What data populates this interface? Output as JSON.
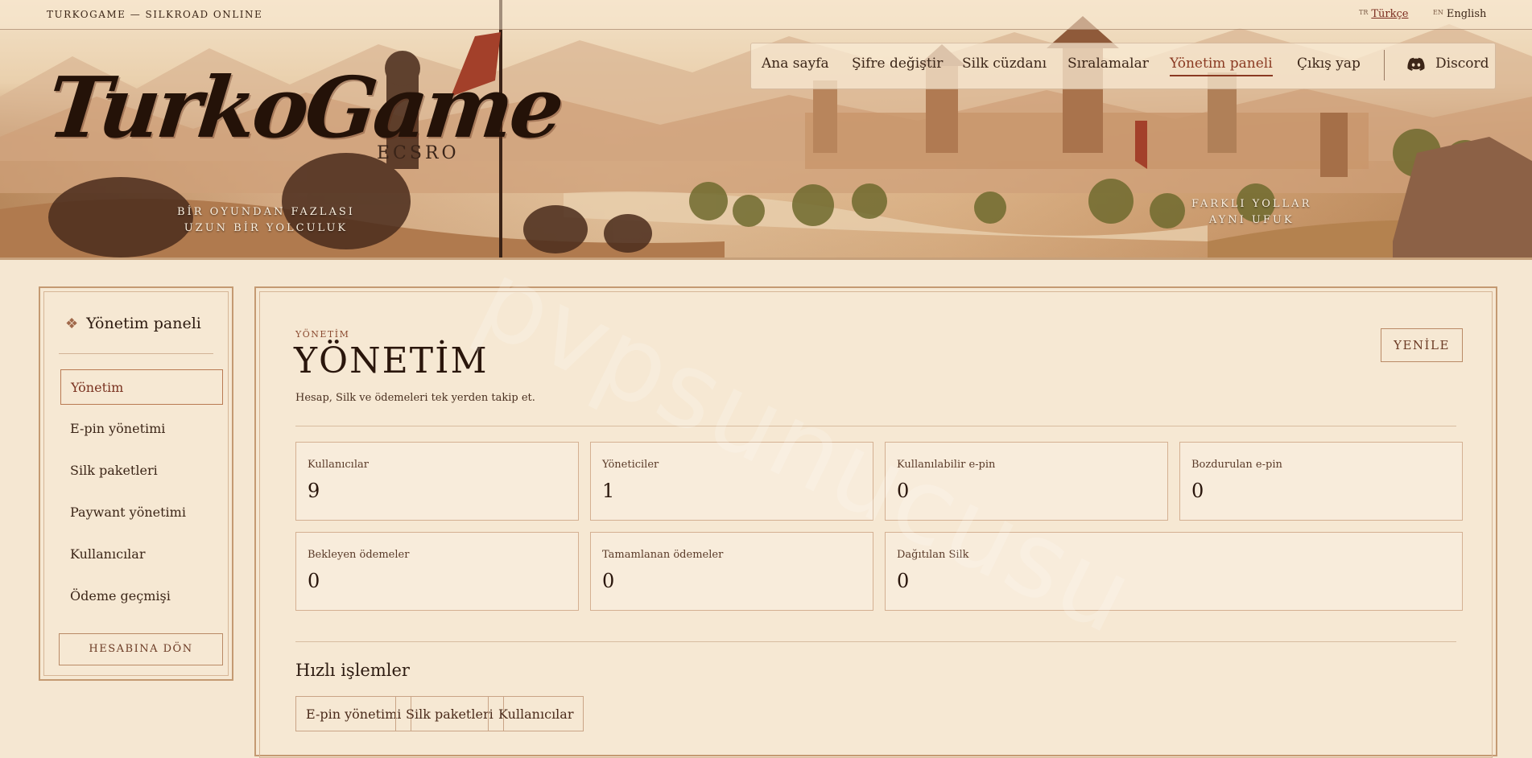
{
  "topbar": {
    "brand": "TURKOGAME — SILKROAD ONLINE",
    "languages": [
      {
        "code": "TR",
        "label": "Türkçe",
        "active": true
      },
      {
        "code": "EN",
        "label": "English",
        "active": false
      }
    ]
  },
  "nav": {
    "items": [
      {
        "label": "Ana sayfa"
      },
      {
        "label": "Şifre değiştir"
      },
      {
        "label": "Silk cüzdanı"
      },
      {
        "label": "Sıralamalar"
      },
      {
        "label": "Yönetim paneli",
        "active": true
      },
      {
        "label": "Çıkış yap"
      }
    ],
    "discord_label": "Discord",
    "discord_icon": "discord-icon"
  },
  "hero": {
    "logo": "TurkoGame",
    "logo_sub": "ECSRO",
    "tagline_left": [
      "BİR OYUNDAN FAZLASI",
      "UZUN BİR YOLCULUK"
    ],
    "tagline_right": [
      "FARKLI YOLLAR",
      "AYNI UFUK"
    ]
  },
  "sidebar": {
    "title": "Yönetim paneli",
    "title_icon": "diamond-icon",
    "items": [
      {
        "label": "Yönetim",
        "active": true
      },
      {
        "label": "E-pin yönetimi"
      },
      {
        "label": "Silk paketleri"
      },
      {
        "label": "Paywant yönetimi"
      },
      {
        "label": "Kullanıcılar"
      },
      {
        "label": "Ödeme geçmişi"
      }
    ],
    "back_button": "HESABINA DÖN"
  },
  "main": {
    "eyebrow": "YÖNETİM",
    "title": "YÖNETİM",
    "description": "Hesap, Silk ve ödemeleri tek yerden takip et.",
    "refresh_button": "YENİLE",
    "stats": [
      {
        "label": "Kullanıcılar",
        "value": "9"
      },
      {
        "label": "Yöneticiler",
        "value": "1"
      },
      {
        "label": "Kullanılabilir e-pin",
        "value": "0"
      },
      {
        "label": "Bozdurulan e-pin",
        "value": "0"
      },
      {
        "label": "Bekleyen ödemeler",
        "value": "0"
      },
      {
        "label": "Tamamlanan ödemeler",
        "value": "0"
      },
      {
        "label": "Dağıtılan Silk",
        "value": "0"
      }
    ],
    "quick_actions_title": "Hızlı işlemler",
    "quick_actions": [
      {
        "label": "E-pin yönetimi"
      },
      {
        "label": "Silk paketleri"
      },
      {
        "label": "Kullanıcılar"
      }
    ]
  },
  "watermark": "pvpsunucusu",
  "colors": {
    "background": "#f5e7d2",
    "accent": "#8a3a22",
    "border": "#c49a72",
    "text": "#3b2417"
  }
}
